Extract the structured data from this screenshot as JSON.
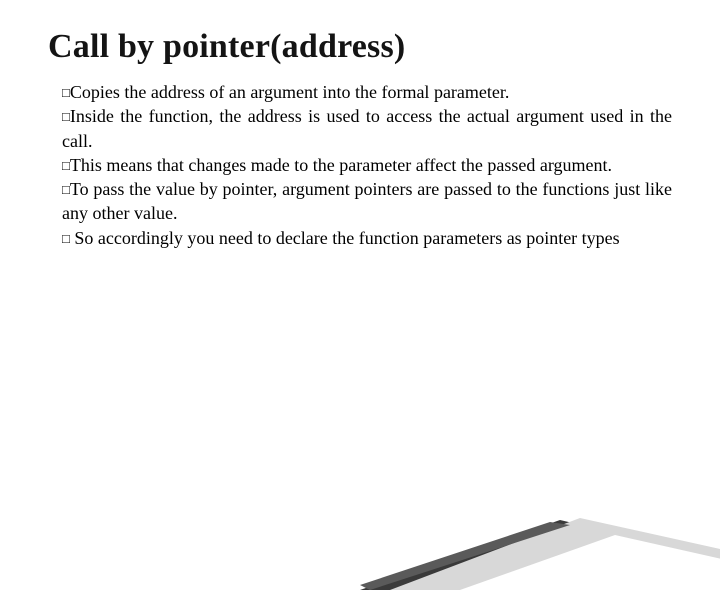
{
  "title": "Call by pointer(address)",
  "bullet_glyph": "□",
  "bullets": [
    "Copies the address of an argument into the formal parameter.",
    "Inside the function, the address is used to access the actual argument used in the call.",
    "This means that changes made to the parameter affect the passed argument.",
    "To pass the value by pointer, argument pointers are passed to the functions just like any other value.",
    " So accordingly you need to declare the function parameters as pointer types"
  ]
}
